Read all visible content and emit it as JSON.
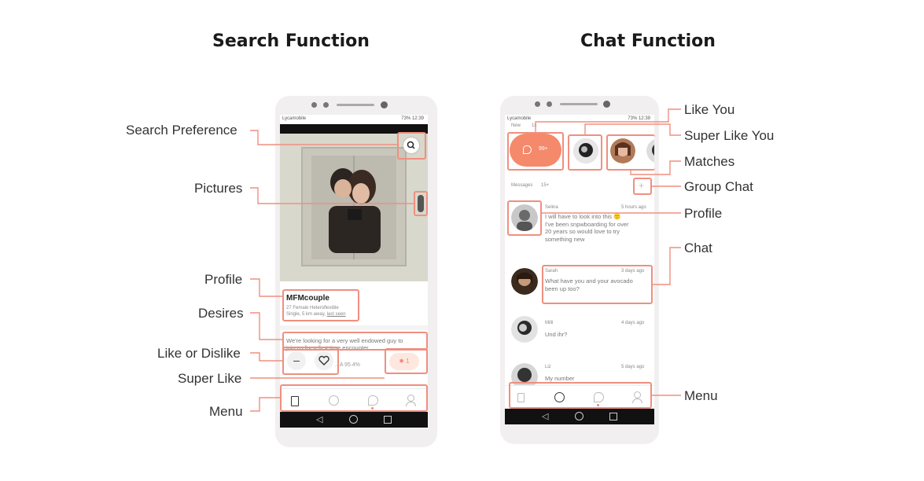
{
  "headings": {
    "left": "Search Function",
    "right": "Chat Function"
  },
  "left_callouts": {
    "search_preference": "Search Preference",
    "pictures": "Pictures",
    "profile": "Profile",
    "desires": "Desires",
    "like_dislike": "Like or Dislike",
    "super_like": "Super Like",
    "menu": "Menu"
  },
  "right_callouts": {
    "like_you": "Like You",
    "super_like_you": "Super Like You",
    "matches": "Matches",
    "group_chat": "Group Chat",
    "profile": "Profile",
    "chat": "Chat",
    "menu": "Menu"
  },
  "search_phone": {
    "carrier": "Lycamobile",
    "status_right": "73% 12:39",
    "profile_name": "MFMcouple",
    "profile_line1": "27 Female Heteroflexible",
    "profile_line2": "Single, 5 km away,",
    "profile_last_seen": "last seen",
    "desires_text_1": "We're looking for a very well endowed guy to",
    "desires_text_2": "join us for a first time encounter",
    "desires_text_3": "...A 95.4%",
    "super_like_count": "1"
  },
  "chat_phone": {
    "carrier": "Lycamobile",
    "status_right": "73% 12:39",
    "tab_new": "New",
    "tab_count": "1s",
    "likes_count": "99+",
    "messages_label": "Messages",
    "messages_count": "15+",
    "messages": [
      {
        "name": "Selina",
        "time": "5 hours ago",
        "lines": [
          "I will have to look into this 🙂",
          "I've been snpwboarding for over",
          "20 years so would love to try",
          "something new"
        ]
      },
      {
        "name": "Sarah",
        "time": "3 days ago",
        "lines": [
          "What have you and your avocado",
          "been up too?"
        ]
      },
      {
        "name": "Milli",
        "time": "4 days ago",
        "lines": [
          "Und ihr?"
        ]
      },
      {
        "name": "Liz",
        "time": "5 days ago",
        "lines": [
          "My number"
        ]
      }
    ]
  },
  "colors": {
    "accent": "#f08f7f",
    "orange": "#f5896b",
    "highlight": "#f08f7f"
  }
}
